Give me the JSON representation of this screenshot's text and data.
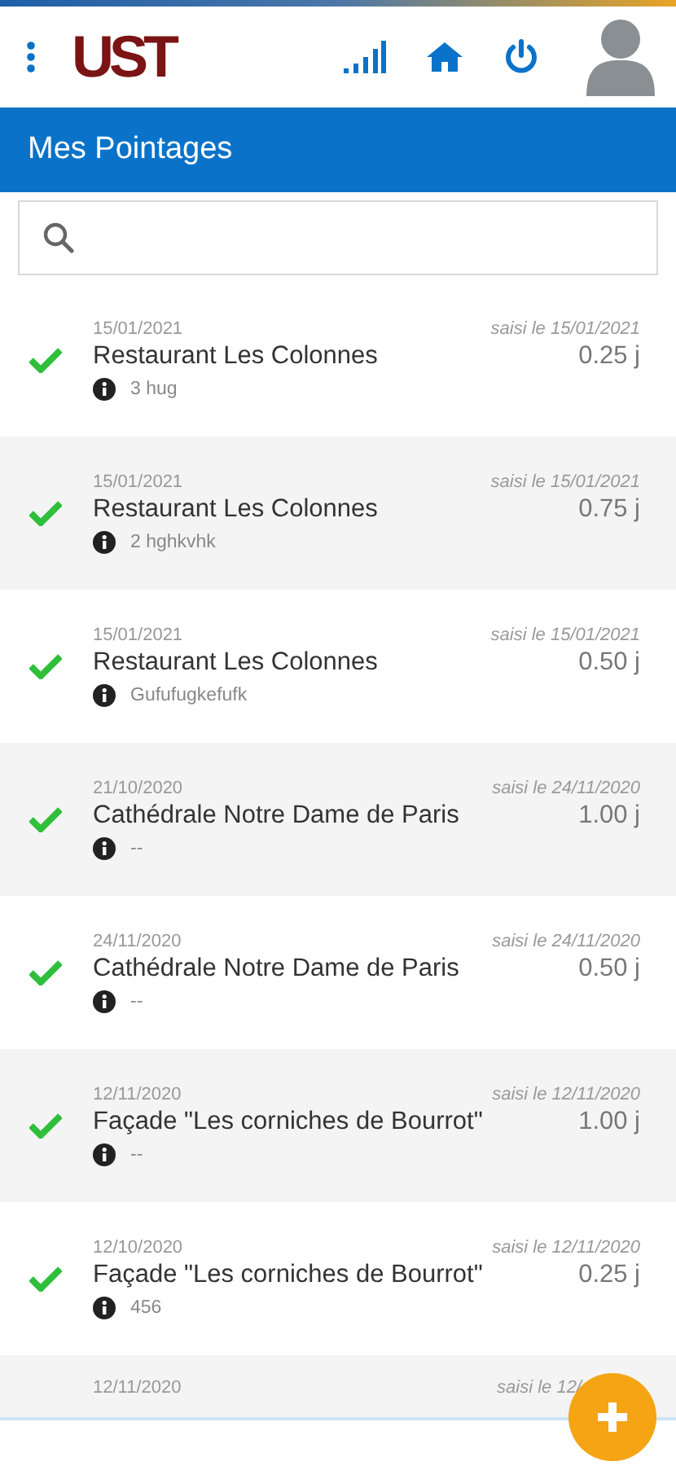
{
  "header": {
    "logo": "UST"
  },
  "title": "Mes Pointages",
  "entries": [
    {
      "date": "15/01/2021",
      "entered": "saisi le 15/01/2021",
      "site": "Restaurant Les Colonnes",
      "days": "0.25 j",
      "note": "3 hug",
      "validated": true
    },
    {
      "date": "15/01/2021",
      "entered": "saisi le 15/01/2021",
      "site": "Restaurant Les Colonnes",
      "days": "0.75 j",
      "note": "2 hghkvhk",
      "validated": true
    },
    {
      "date": "15/01/2021",
      "entered": "saisi le 15/01/2021",
      "site": "Restaurant Les Colonnes",
      "days": "0.50 j",
      "note": "Gufufugkefufk",
      "validated": true
    },
    {
      "date": "21/10/2020",
      "entered": "saisi le 24/11/2020",
      "site": "Cathédrale Notre Dame de Paris",
      "days": "1.00 j",
      "note": "--",
      "validated": true
    },
    {
      "date": "24/11/2020",
      "entered": "saisi le 24/11/2020",
      "site": "Cathédrale Notre Dame de Paris",
      "days": "0.50 j",
      "note": "--",
      "validated": true
    },
    {
      "date": "12/11/2020",
      "entered": "saisi le 12/11/2020",
      "site": "Façade \"Les corniches de Bourrot\"",
      "days": "1.00 j",
      "note": "--",
      "validated": true
    },
    {
      "date": "12/10/2020",
      "entered": "saisi le 12/11/2020",
      "site": "Façade \"Les corniches de Bourrot\"",
      "days": "0.25 j",
      "note": "456",
      "validated": true
    },
    {
      "date": "12/11/2020",
      "entered": "saisi le 12/"
    }
  ]
}
